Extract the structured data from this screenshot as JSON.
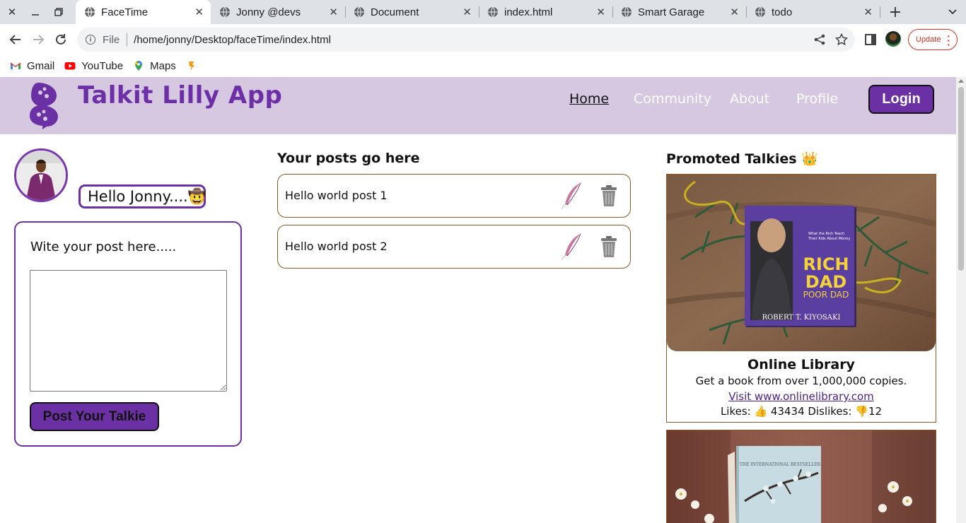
{
  "browser": {
    "tabs": [
      {
        "label": "FaceTime",
        "active": true
      },
      {
        "label": "Jonny @devs",
        "active": false
      },
      {
        "label": "Document",
        "active": false
      },
      {
        "label": "index.html",
        "active": false
      },
      {
        "label": "Smart Garage",
        "active": false
      },
      {
        "label": "todo",
        "active": false
      }
    ],
    "address": {
      "scheme": "File",
      "url": "/home/jonny/Desktop/faceTime/index.html"
    },
    "update_label": "Update",
    "bookmarks": [
      {
        "label": "Gmail",
        "icon": "gmail-icon"
      },
      {
        "label": "YouTube",
        "icon": "youtube-icon"
      },
      {
        "label": "Maps",
        "icon": "maps-icon"
      }
    ]
  },
  "app": {
    "title": "Talkit Lilly App",
    "nav": [
      {
        "label": "Home",
        "active": true
      },
      {
        "label": "Community",
        "active": false
      },
      {
        "label": "About",
        "active": false
      },
      {
        "label": "Profile",
        "active": false
      }
    ],
    "login_label": "Login",
    "accent_color": "#6b30a3",
    "header_bg": "#d7c8e2"
  },
  "user": {
    "greeting": "Hello Jonny....🤠"
  },
  "composer": {
    "prompt": "Wite your post here.....",
    "textarea_value": "",
    "submit_label": "Post Your Talkie"
  },
  "posts": {
    "heading": "Your posts go here",
    "items": [
      {
        "text": "Hello world post 1"
      },
      {
        "text": "Hello world post 2"
      }
    ]
  },
  "promoted": {
    "heading": "Promoted Talkies 👑",
    "items": [
      {
        "title": "Online Library",
        "description": "Get a book from over 1,000,000 copies.",
        "link_text": "Visit www.onlinelibrary.com",
        "likes_text": "Likes: 👍 43434 Dislikes: 👎12",
        "book_lines": [
          "RICH",
          "DAD",
          "POOR DAD",
          "ROBERT T. KIYOSAKI"
        ]
      },
      {
        "book_banner": "THE INTERNATIONAL BESTSELLER"
      }
    ]
  }
}
